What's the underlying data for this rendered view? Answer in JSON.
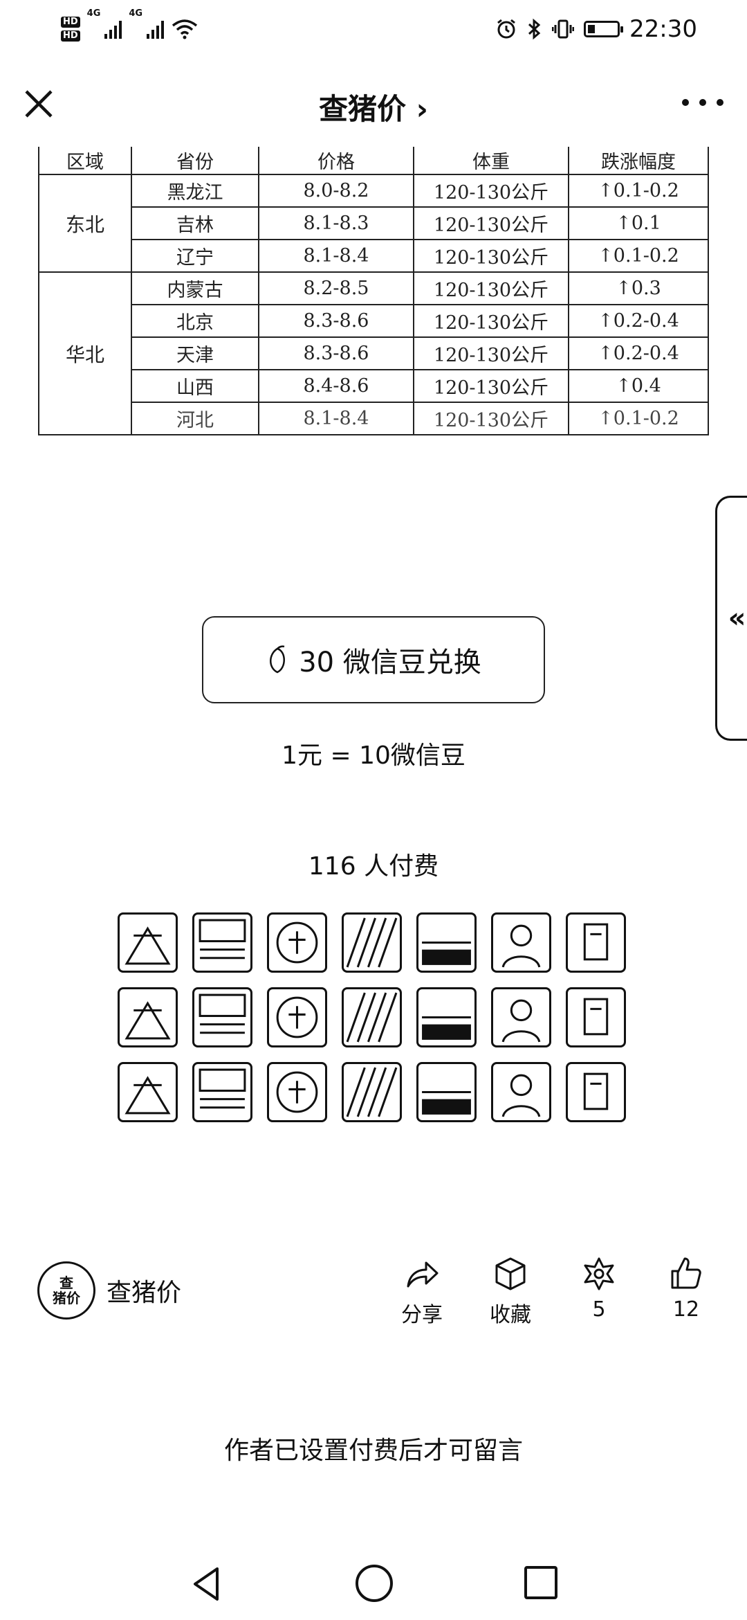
{
  "status_bar": {
    "hd1": "HD",
    "hd2": "HD",
    "net1": "4G",
    "net2": "4G",
    "battery_level": 0.25,
    "time": "22:30",
    "icons": [
      "alarm-icon",
      "bluetooth-icon",
      "vibrate-icon",
      "battery-icon",
      "wifi-icon",
      "signal-icon"
    ]
  },
  "topbar": {
    "title": "查猪价 ›"
  },
  "table": {
    "headers": [
      "区域",
      "省份",
      "价格",
      "体重",
      "跌涨幅度"
    ],
    "regions": [
      {
        "name": "东北",
        "rows": [
          {
            "province": "黑龙江",
            "price": "8.0-8.2",
            "weight": "120-130公斤",
            "change": "↑0.1-0.2"
          },
          {
            "province": "吉林",
            "price": "8.1-8.3",
            "weight": "120-130公斤",
            "change": "↑0.1"
          },
          {
            "province": "辽宁",
            "price": "8.1-8.4",
            "weight": "120-130公斤",
            "change": "↑0.1-0.2"
          }
        ]
      },
      {
        "name": "华北",
        "rows": [
          {
            "province": "内蒙古",
            "price": "8.2-8.5",
            "weight": "120-130公斤",
            "change": "↑0.3"
          },
          {
            "province": "北京",
            "price": "8.3-8.6",
            "weight": "120-130公斤",
            "change": "↑0.2-0.4"
          },
          {
            "province": "天津",
            "price": "8.3-8.6",
            "weight": "120-130公斤",
            "change": "↑0.2-0.4"
          },
          {
            "province": "山西",
            "price": "8.4-8.6",
            "weight": "120-130公斤",
            "change": "↑0.4"
          },
          {
            "province": "河北",
            "price": "8.1-8.4",
            "weight": "120-130公斤",
            "change": "↑0.1-0.2"
          }
        ]
      }
    ]
  },
  "side_tab": {
    "label": "«"
  },
  "redeem": {
    "button_label": "30 微信豆兑换",
    "rate": "1元 = 10微信豆"
  },
  "paid": {
    "count_text": "116 人付费",
    "avatars": [
      "avatar",
      "avatar",
      "avatar",
      "avatar",
      "avatar",
      "avatar",
      "avatar",
      "avatar",
      "avatar",
      "avatar",
      "avatar",
      "avatar",
      "avatar",
      "avatar",
      "avatar",
      "avatar",
      "avatar",
      "avatar",
      "avatar",
      "avatar",
      "avatar"
    ]
  },
  "author": {
    "avatar_top": "查",
    "avatar_bottom": "猪价",
    "name": "查猪价"
  },
  "actions": {
    "share": "分享",
    "favorite": "收藏",
    "wow_count": "5",
    "like_count": "12"
  },
  "comment_note": "作者已设置付费后才可留言"
}
